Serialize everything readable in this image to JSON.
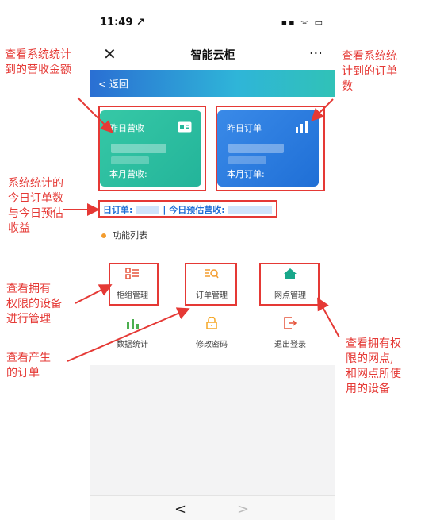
{
  "status": {
    "time": "11:49 ↗",
    "icons": "▪▪ ᯤ ▭"
  },
  "header": {
    "close": "✕",
    "title": "智能云柜",
    "more": "···"
  },
  "nav": {
    "back": "< 返回"
  },
  "cards": {
    "revenue": {
      "title": "昨日营收",
      "sub": "本月营收:"
    },
    "orders": {
      "title": "昨日订单",
      "sub": "本月订单:"
    }
  },
  "summary": {
    "orders_label": "日订单:",
    "sep": "| 今日预估营收:"
  },
  "features": {
    "label": "功能列表"
  },
  "grid": {
    "cabinet": "柜组管理",
    "orders": "订单管理",
    "outlets": "网点管理",
    "stats": "数据统计",
    "password": "修改密码",
    "logout": "退出登录"
  },
  "browser": {
    "back": "<",
    "forward": ">"
  },
  "annotations": {
    "a1": "查看系统统计\n到的营收金额",
    "a2": "查看系统统\n计到的订单\n数",
    "a3": "系统统计的\n今日订单数\n与今日预估\n收益",
    "a4": "查看拥有\n权限的设备\n进行管理",
    "a5": "查看产生\n的订单",
    "a6": "查看拥有权\n限的网点,\n和网点所使\n用的设备"
  },
  "colors": {
    "accent": "#1f6fd6",
    "annotation": "#e53935",
    "card_green": "#27b89c",
    "card_blue": "#2a7ce0"
  }
}
